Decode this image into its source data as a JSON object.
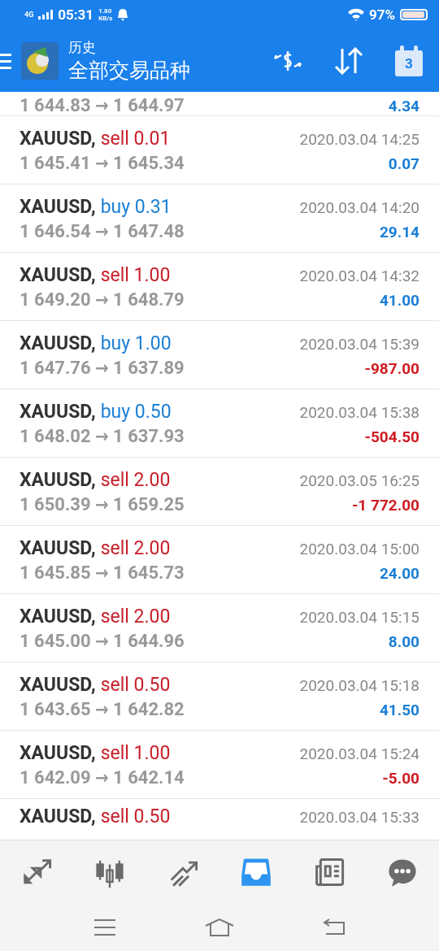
{
  "status_bar": {
    "network": "4G",
    "time": "05:31",
    "speed_value": "1.80",
    "speed_unit": "KB/s",
    "battery": "97%"
  },
  "header": {
    "title": "历史",
    "subtitle": "全部交易品种",
    "calendar_day": "3"
  },
  "partial_top": {
    "prices": "1 644.83 → 1 644.97",
    "profit": "4.34",
    "loss": false
  },
  "trades": [
    {
      "symbol": "XAUUSD,",
      "kind": "sell",
      "order": "sell 0.01",
      "time": "2020.03.04 14:25",
      "prices": "1 645.41 → 1 645.34",
      "profit": "0.07",
      "loss": false
    },
    {
      "symbol": "XAUUSD,",
      "kind": "buy",
      "order": "buy 0.31",
      "time": "2020.03.04 14:20",
      "prices": "1 646.54 → 1 647.48",
      "profit": "29.14",
      "loss": false
    },
    {
      "symbol": "XAUUSD,",
      "kind": "sell",
      "order": "sell 1.00",
      "time": "2020.03.04 14:32",
      "prices": "1 649.20 → 1 648.79",
      "profit": "41.00",
      "loss": false
    },
    {
      "symbol": "XAUUSD,",
      "kind": "buy",
      "order": "buy 1.00",
      "time": "2020.03.04 15:39",
      "prices": "1 647.76 → 1 637.89",
      "profit": "-987.00",
      "loss": true
    },
    {
      "symbol": "XAUUSD,",
      "kind": "buy",
      "order": "buy 0.50",
      "time": "2020.03.04 15:38",
      "prices": "1 648.02 → 1 637.93",
      "profit": "-504.50",
      "loss": true
    },
    {
      "symbol": "XAUUSD,",
      "kind": "sell",
      "order": "sell 2.00",
      "time": "2020.03.05 16:25",
      "prices": "1 650.39 → 1 659.25",
      "profit": "-1 772.00",
      "loss": true
    },
    {
      "symbol": "XAUUSD,",
      "kind": "sell",
      "order": "sell 2.00",
      "time": "2020.03.04 15:00",
      "prices": "1 645.85 → 1 645.73",
      "profit": "24.00",
      "loss": false
    },
    {
      "symbol": "XAUUSD,",
      "kind": "sell",
      "order": "sell 2.00",
      "time": "2020.03.04 15:15",
      "prices": "1 645.00 → 1 644.96",
      "profit": "8.00",
      "loss": false
    },
    {
      "symbol": "XAUUSD,",
      "kind": "sell",
      "order": "sell 0.50",
      "time": "2020.03.04 15:18",
      "prices": "1 643.65 → 1 642.82",
      "profit": "41.50",
      "loss": false
    },
    {
      "symbol": "XAUUSD,",
      "kind": "sell",
      "order": "sell 1.00",
      "time": "2020.03.04 15:24",
      "prices": "1 642.09 → 1 642.14",
      "profit": "-5.00",
      "loss": true
    }
  ],
  "partial_bottom": {
    "symbol": "XAUUSD,",
    "kind": "sell",
    "order": "sell 0.50",
    "time": "2020.03.04 15:33"
  },
  "bottom_nav": [
    {
      "kind": "quotes",
      "selected": false
    },
    {
      "kind": "chart",
      "selected": false
    },
    {
      "kind": "trade",
      "selected": false
    },
    {
      "kind": "history",
      "selected": true
    },
    {
      "kind": "news",
      "selected": false
    },
    {
      "kind": "chat",
      "selected": false
    }
  ]
}
